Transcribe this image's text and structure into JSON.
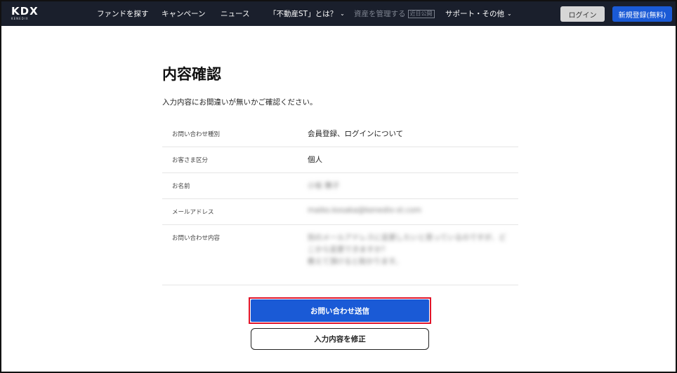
{
  "header": {
    "logo": "KDX",
    "logo_sub": "KENEDIX",
    "nav": [
      {
        "label": "ファンドを探す"
      },
      {
        "label": "キャンペーン"
      },
      {
        "label": "ニュース"
      },
      {
        "label": "「不動産ST」とは？",
        "icon": "chevron-down-icon"
      },
      {
        "label": "資産を管理する",
        "badge": "近日公開"
      },
      {
        "label": "サポート・その他",
        "icon": "chevron-down-icon"
      }
    ],
    "login_label": "ログイン",
    "register_label": "新規登録(無料)"
  },
  "main": {
    "title": "内容確認",
    "lead": "入力内容にお間違いが無いかご確認ください。",
    "rows": [
      {
        "label": "お問い合わせ種別",
        "value": "会員登録、ログインについて"
      },
      {
        "label": "お客さま区分",
        "value": "個人"
      },
      {
        "label": "お名前",
        "value": "小坂 舞子"
      },
      {
        "label": "メールアドレス",
        "value": "maiko.kosaka@kenedix-st.com"
      },
      {
        "label": "お問い合わせ内容",
        "value_lines": [
          "別のメールアドレスに変更したいと思っているのですが、ど",
          "こから変更できますか？",
          "教えて頂けると助かります。"
        ]
      }
    ],
    "submit_label": "お問い合わせ送信",
    "edit_label": "入力内容を修正"
  },
  "colors": {
    "header_bg": "#1a1f2c",
    "primary": "#1a5ad6",
    "highlight": "#e0142a"
  }
}
